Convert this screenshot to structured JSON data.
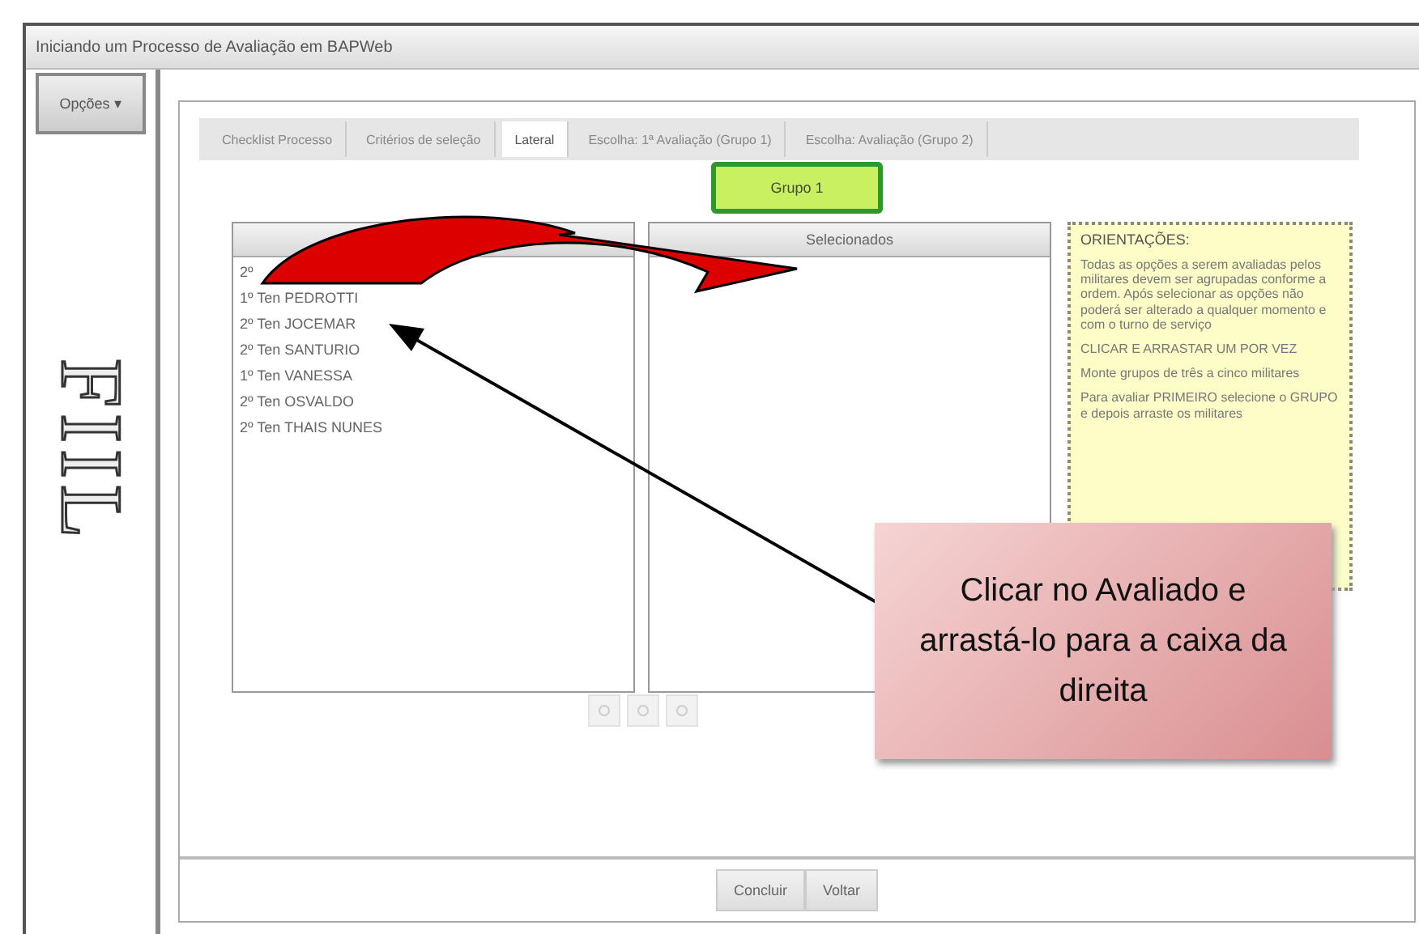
{
  "window": {
    "title": "Iniciando um Processo de Avaliação em BAPWeb"
  },
  "options_button": {
    "label": "Opções ▾"
  },
  "logo": {
    "text": "FIIL"
  },
  "tabs": [
    {
      "label": "Checklist Processo",
      "selected": false
    },
    {
      "label": "Critérios de seleção",
      "selected": false
    },
    {
      "label": "Lateral",
      "selected": true
    },
    {
      "label": "Escolha: 1ª Avaliação (Grupo 1)",
      "selected": false
    },
    {
      "label": "Escolha: Avaliação (Grupo 2)",
      "selected": false
    }
  ],
  "group_button": {
    "label": "Grupo 1"
  },
  "available_list": {
    "items": [
      "2º",
      "1º Ten PEDROTTI",
      "2º Ten JOCEMAR",
      "2º Ten SANTURIO",
      "1º Ten VANESSA",
      "2º Ten OSVALDO",
      "2º Ten THAIS NUNES"
    ]
  },
  "selected_list": {
    "header": "Selecionados"
  },
  "guidance": {
    "title": "ORIENTAÇÕES:",
    "paragraphs": [
      "Todas as opções a serem avaliadas pelos militares devem ser agrupadas conforme a ordem. Após selecionar as opções não poderá ser alterado a qualquer momento e com o turno de serviço",
      "CLICAR E ARRASTAR UM POR VEZ",
      "Monte grupos de três a cinco militares",
      "Para avaliar PRIMEIRO selecione o GRUPO e depois arraste os militares"
    ]
  },
  "callout": {
    "text": "Clicar no Avaliado e arrastá-lo para a caixa da direita"
  },
  "footer_buttons": [
    "Concluir",
    "Voltar"
  ]
}
